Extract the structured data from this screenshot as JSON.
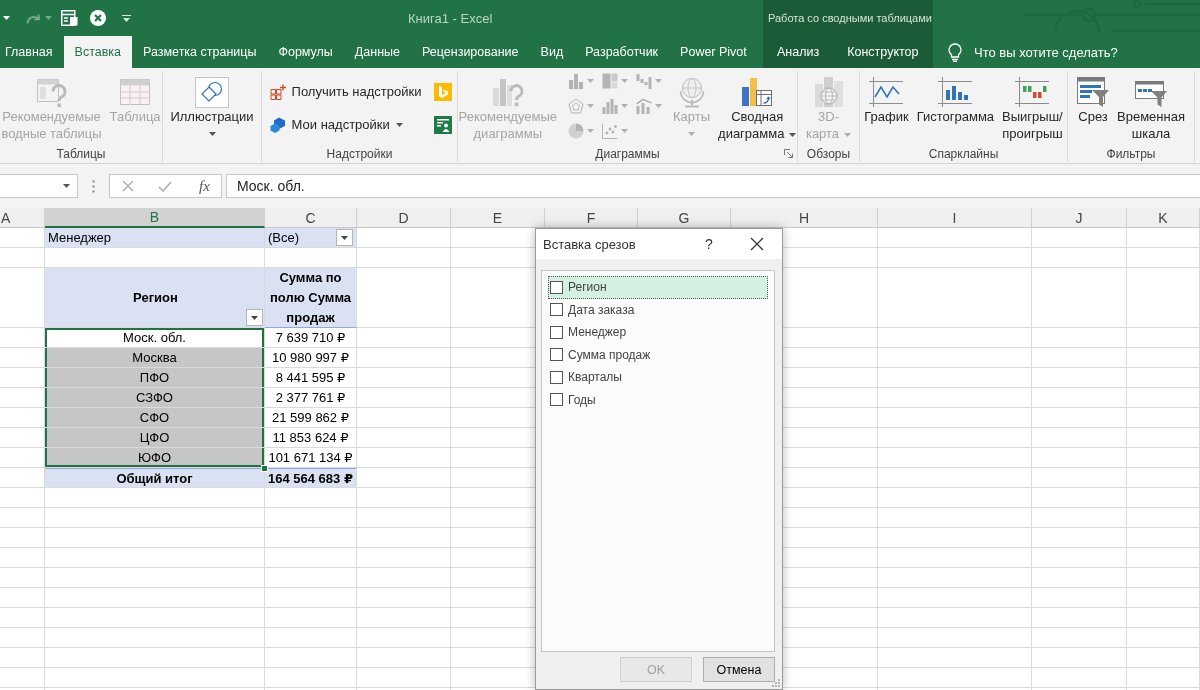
{
  "title_bar": {
    "title": "Книга1 - Excel",
    "context_label": "Работа со сводными таблицами"
  },
  "tabs": [
    {
      "label": "Главная",
      "selected": false,
      "kind": "main"
    },
    {
      "label": "Вставка",
      "selected": true,
      "kind": "main"
    },
    {
      "label": "Разметка страницы",
      "selected": false,
      "kind": "main"
    },
    {
      "label": "Формулы",
      "selected": false,
      "kind": "main"
    },
    {
      "label": "Данные",
      "selected": false,
      "kind": "main"
    },
    {
      "label": "Рецензирование",
      "selected": false,
      "kind": "main"
    },
    {
      "label": "Вид",
      "selected": false,
      "kind": "main"
    },
    {
      "label": "Разработчик",
      "selected": false,
      "kind": "main"
    },
    {
      "label": "Power Pivot",
      "selected": false,
      "kind": "main"
    },
    {
      "label": "Анализ",
      "selected": false,
      "kind": "context"
    },
    {
      "label": "Конструктор",
      "selected": false,
      "kind": "context"
    }
  ],
  "tell_me": {
    "placeholder": "Что вы хотите сделать?"
  },
  "ribbon": {
    "groups": [
      {
        "label": "Таблицы",
        "launcher": false,
        "commands": [
          {
            "kind": "large",
            "label": "Рекомендуемые\nводные таблицы",
            "disabled": true,
            "dropdown": false
          },
          {
            "kind": "large",
            "label": "Таблица",
            "disabled": true,
            "dropdown": false
          }
        ]
      },
      {
        "launcher": false,
        "commands": [
          {
            "kind": "large",
            "label": "Иллюстрации",
            "disabled": false,
            "dropdown": true
          }
        ]
      },
      {
        "label": "Надстройки",
        "launcher": false,
        "commands": [
          {
            "kind": "small",
            "label": "Получить надстройки",
            "disabled": false,
            "dropdown": false
          },
          {
            "kind": "small",
            "label": "Мои надстройки",
            "disabled": false,
            "dropdown": true
          },
          {
            "kind": "icon",
            "disabled": false
          },
          {
            "kind": "icon",
            "disabled": false
          }
        ]
      },
      {
        "label": "Диаграммы",
        "launcher": true,
        "commands": [
          {
            "kind": "large",
            "label": "Рекомендуемые\nдиаграммы",
            "disabled": true,
            "dropdown": false
          },
          {
            "kind": "mini",
            "disabled": true,
            "dropdown": true
          },
          {
            "kind": "mini",
            "disabled": true,
            "dropdown": true
          },
          {
            "kind": "mini",
            "disabled": true,
            "dropdown": true
          },
          {
            "kind": "mini",
            "disabled": true,
            "dropdown": true
          },
          {
            "kind": "mini",
            "disabled": true,
            "dropdown": true
          },
          {
            "kind": "mini",
            "disabled": true,
            "dropdown": true
          },
          {
            "kind": "mini",
            "disabled": true,
            "dropdown": true
          },
          {
            "kind": "mini",
            "disabled": true,
            "dropdown": true
          },
          {
            "kind": "large",
            "label": "Карты",
            "disabled": true,
            "dropdown": true
          },
          {
            "kind": "large",
            "label": "Сводная\nдиаграмма",
            "disabled": false,
            "dropdown": true
          }
        ]
      },
      {
        "label": "Обзоры",
        "launcher": false,
        "commands": [
          {
            "kind": "large",
            "label": "3D-\nкарта",
            "disabled": true,
            "dropdown": true
          }
        ]
      },
      {
        "label": "Спарклайны",
        "launcher": false,
        "commands": [
          {
            "kind": "large",
            "label": "График",
            "disabled": false,
            "dropdown": false
          },
          {
            "kind": "large",
            "label": "Гистограмма",
            "disabled": false,
            "dropdown": false
          },
          {
            "kind": "large",
            "label": "Выигрыш/\nпроигрыш",
            "disabled": false,
            "dropdown": false
          }
        ]
      },
      {
        "label": "Фильтры",
        "launcher": false,
        "commands": [
          {
            "kind": "large",
            "label": "Срез",
            "disabled": false,
            "dropdown": false
          },
          {
            "kind": "large",
            "label": "Временная\nшкала",
            "disabled": false,
            "dropdown": false
          }
        ]
      }
    ]
  },
  "formula_bar": {
    "insert_function": "fx",
    "value": "Моск. обл."
  },
  "sheet": {
    "columns": [
      {
        "label": "A",
        "selected": false
      },
      {
        "label": "B",
        "selected": true
      },
      {
        "label": "C",
        "selected": false
      },
      {
        "label": "D",
        "selected": false
      },
      {
        "label": "E",
        "selected": false
      },
      {
        "label": "F",
        "selected": false
      },
      {
        "label": "G",
        "selected": false
      },
      {
        "label": "H",
        "selected": false
      },
      {
        "label": "I",
        "selected": false
      },
      {
        "label": "J",
        "selected": false
      },
      {
        "label": "K",
        "selected": false
      }
    ],
    "pivot": {
      "filter": {
        "field": "Менеджер",
        "value": "(Все)"
      },
      "row_header": "Регион",
      "value_header": "Сумма по полю Сумма продаж",
      "rows": [
        {
          "label": "Моск. обл.",
          "value": "7 639 710 ₽",
          "selected": true,
          "active": true
        },
        {
          "label": "Москва",
          "value": "10 980 997 ₽",
          "selected": true,
          "active": false
        },
        {
          "label": "ПФО",
          "value": "8 441 595 ₽",
          "selected": true,
          "active": false
        },
        {
          "label": "СЗФО",
          "value": "2 377 761 ₽",
          "selected": true,
          "active": false
        },
        {
          "label": "СФО",
          "value": "21 599 862 ₽",
          "selected": true,
          "active": false
        },
        {
          "label": "ЦФО",
          "value": "11 853 624 ₽",
          "selected": true,
          "active": false
        },
        {
          "label": "ЮФО",
          "value": "101 671 134 ₽",
          "selected": true,
          "active": false
        }
      ],
      "total": {
        "label": "Общий итог",
        "value": "164 564 683 ₽"
      }
    }
  },
  "dialog": {
    "title": "Вставка срезов",
    "help": "?",
    "fields": [
      {
        "label": "Регион",
        "checked": false,
        "selected": true
      },
      {
        "label": "Дата заказа",
        "checked": false,
        "selected": false
      },
      {
        "label": "Менеджер",
        "checked": false,
        "selected": false
      },
      {
        "label": "Сумма продаж",
        "checked": false,
        "selected": false
      },
      {
        "label": "Кварталы",
        "checked": false,
        "selected": false
      },
      {
        "label": "Годы",
        "checked": false,
        "selected": false
      }
    ],
    "buttons": [
      {
        "label": "OK",
        "disabled": true
      },
      {
        "label": "Отмена",
        "disabled": false
      }
    ]
  }
}
